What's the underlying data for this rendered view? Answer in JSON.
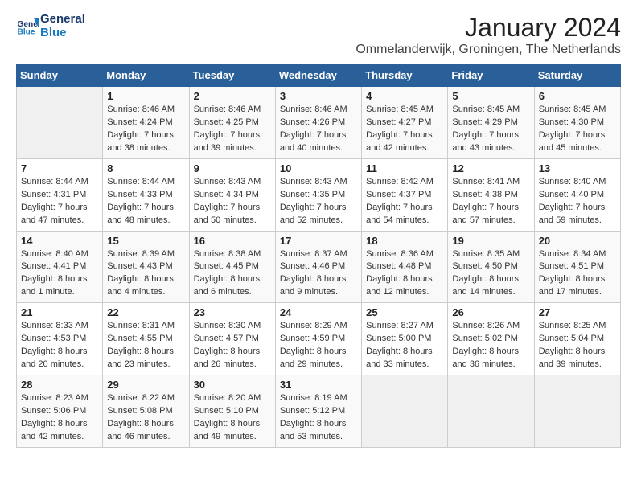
{
  "logo": {
    "line1": "General",
    "line2": "Blue"
  },
  "title": "January 2024",
  "subtitle": "Ommelanderwijk, Groningen, The Netherlands",
  "headers": [
    "Sunday",
    "Monday",
    "Tuesday",
    "Wednesday",
    "Thursday",
    "Friday",
    "Saturday"
  ],
  "weeks": [
    [
      {
        "day": "",
        "sunrise": "",
        "sunset": "",
        "daylight": ""
      },
      {
        "day": "1",
        "sunrise": "8:46 AM",
        "sunset": "4:24 PM",
        "daylight": "7 hours and 38 minutes."
      },
      {
        "day": "2",
        "sunrise": "8:46 AM",
        "sunset": "4:25 PM",
        "daylight": "7 hours and 39 minutes."
      },
      {
        "day": "3",
        "sunrise": "8:46 AM",
        "sunset": "4:26 PM",
        "daylight": "7 hours and 40 minutes."
      },
      {
        "day": "4",
        "sunrise": "8:45 AM",
        "sunset": "4:27 PM",
        "daylight": "7 hours and 42 minutes."
      },
      {
        "day": "5",
        "sunrise": "8:45 AM",
        "sunset": "4:29 PM",
        "daylight": "7 hours and 43 minutes."
      },
      {
        "day": "6",
        "sunrise": "8:45 AM",
        "sunset": "4:30 PM",
        "daylight": "7 hours and 45 minutes."
      }
    ],
    [
      {
        "day": "7",
        "sunrise": "8:44 AM",
        "sunset": "4:31 PM",
        "daylight": "7 hours and 47 minutes."
      },
      {
        "day": "8",
        "sunrise": "8:44 AM",
        "sunset": "4:33 PM",
        "daylight": "7 hours and 48 minutes."
      },
      {
        "day": "9",
        "sunrise": "8:43 AM",
        "sunset": "4:34 PM",
        "daylight": "7 hours and 50 minutes."
      },
      {
        "day": "10",
        "sunrise": "8:43 AM",
        "sunset": "4:35 PM",
        "daylight": "7 hours and 52 minutes."
      },
      {
        "day": "11",
        "sunrise": "8:42 AM",
        "sunset": "4:37 PM",
        "daylight": "7 hours and 54 minutes."
      },
      {
        "day": "12",
        "sunrise": "8:41 AM",
        "sunset": "4:38 PM",
        "daylight": "7 hours and 57 minutes."
      },
      {
        "day": "13",
        "sunrise": "8:40 AM",
        "sunset": "4:40 PM",
        "daylight": "7 hours and 59 minutes."
      }
    ],
    [
      {
        "day": "14",
        "sunrise": "8:40 AM",
        "sunset": "4:41 PM",
        "daylight": "8 hours and 1 minute."
      },
      {
        "day": "15",
        "sunrise": "8:39 AM",
        "sunset": "4:43 PM",
        "daylight": "8 hours and 4 minutes."
      },
      {
        "day": "16",
        "sunrise": "8:38 AM",
        "sunset": "4:45 PM",
        "daylight": "8 hours and 6 minutes."
      },
      {
        "day": "17",
        "sunrise": "8:37 AM",
        "sunset": "4:46 PM",
        "daylight": "8 hours and 9 minutes."
      },
      {
        "day": "18",
        "sunrise": "8:36 AM",
        "sunset": "4:48 PM",
        "daylight": "8 hours and 12 minutes."
      },
      {
        "day": "19",
        "sunrise": "8:35 AM",
        "sunset": "4:50 PM",
        "daylight": "8 hours and 14 minutes."
      },
      {
        "day": "20",
        "sunrise": "8:34 AM",
        "sunset": "4:51 PM",
        "daylight": "8 hours and 17 minutes."
      }
    ],
    [
      {
        "day": "21",
        "sunrise": "8:33 AM",
        "sunset": "4:53 PM",
        "daylight": "8 hours and 20 minutes."
      },
      {
        "day": "22",
        "sunrise": "8:31 AM",
        "sunset": "4:55 PM",
        "daylight": "8 hours and 23 minutes."
      },
      {
        "day": "23",
        "sunrise": "8:30 AM",
        "sunset": "4:57 PM",
        "daylight": "8 hours and 26 minutes."
      },
      {
        "day": "24",
        "sunrise": "8:29 AM",
        "sunset": "4:59 PM",
        "daylight": "8 hours and 29 minutes."
      },
      {
        "day": "25",
        "sunrise": "8:27 AM",
        "sunset": "5:00 PM",
        "daylight": "8 hours and 33 minutes."
      },
      {
        "day": "26",
        "sunrise": "8:26 AM",
        "sunset": "5:02 PM",
        "daylight": "8 hours and 36 minutes."
      },
      {
        "day": "27",
        "sunrise": "8:25 AM",
        "sunset": "5:04 PM",
        "daylight": "8 hours and 39 minutes."
      }
    ],
    [
      {
        "day": "28",
        "sunrise": "8:23 AM",
        "sunset": "5:06 PM",
        "daylight": "8 hours and 42 minutes."
      },
      {
        "day": "29",
        "sunrise": "8:22 AM",
        "sunset": "5:08 PM",
        "daylight": "8 hours and 46 minutes."
      },
      {
        "day": "30",
        "sunrise": "8:20 AM",
        "sunset": "5:10 PM",
        "daylight": "8 hours and 49 minutes."
      },
      {
        "day": "31",
        "sunrise": "8:19 AM",
        "sunset": "5:12 PM",
        "daylight": "8 hours and 53 minutes."
      },
      {
        "day": "",
        "sunrise": "",
        "sunset": "",
        "daylight": ""
      },
      {
        "day": "",
        "sunrise": "",
        "sunset": "",
        "daylight": ""
      },
      {
        "day": "",
        "sunrise": "",
        "sunset": "",
        "daylight": ""
      }
    ]
  ],
  "labels": {
    "sunrise": "Sunrise:",
    "sunset": "Sunset:",
    "daylight": "Daylight:"
  },
  "accent_color": "#2a6099"
}
